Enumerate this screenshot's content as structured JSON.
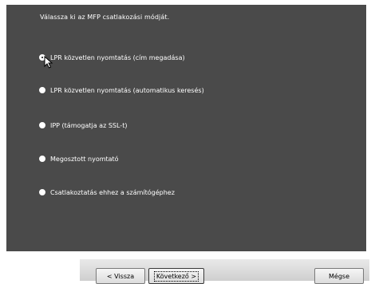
{
  "wizard": {
    "title": "Válassza ki az MFP csatlakozási módját.",
    "options": [
      {
        "label": "LPR közvetlen nyomtatás (cím megadása)",
        "selected": true
      },
      {
        "label": "LPR közvetlen nyomtatás (automatikus keresés)",
        "selected": false
      },
      {
        "label": "IPP (támogatja az SSL-t)",
        "selected": false
      },
      {
        "label": "Megosztott nyomtató",
        "selected": false
      },
      {
        "label": "Csatlakoztatás ehhez a számítógéphez",
        "selected": false
      }
    ]
  },
  "buttons": {
    "back": "< Vissza",
    "next": "Következő >",
    "cancel": "Mégse"
  },
  "colors": {
    "panel": "#4a4a4a",
    "text": "#ffffff"
  }
}
